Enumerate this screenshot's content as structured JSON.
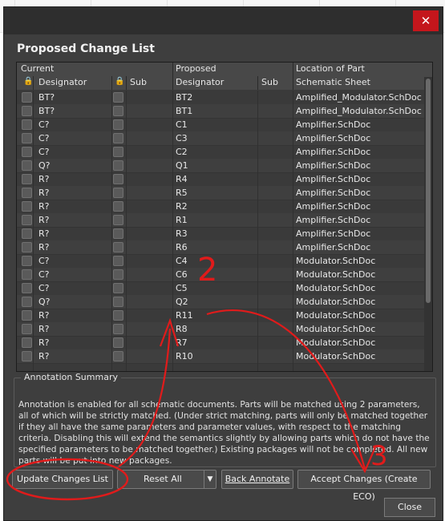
{
  "dialog": {
    "heading": "Proposed Change List",
    "close_x": "✕",
    "close_button": "Close"
  },
  "grid": {
    "group_headers": {
      "current": "Current",
      "proposed": "Proposed",
      "location": "Location of Part"
    },
    "columns": {
      "designator": "Designator",
      "sub": "Sub",
      "proposed_designator": "Designator",
      "proposed_sub": "Sub",
      "schematic_sheet": "Schematic Sheet"
    },
    "rows": [
      {
        "current": "BT?",
        "proposed": "BT2",
        "sheet": "Amplified_Modulator.SchDoc"
      },
      {
        "current": "BT?",
        "proposed": "BT1",
        "sheet": "Amplified_Modulator.SchDoc"
      },
      {
        "current": "C?",
        "proposed": "C1",
        "sheet": "Amplifier.SchDoc"
      },
      {
        "current": "C?",
        "proposed": "C3",
        "sheet": "Amplifier.SchDoc"
      },
      {
        "current": "C?",
        "proposed": "C2",
        "sheet": "Amplifier.SchDoc"
      },
      {
        "current": "Q?",
        "proposed": "Q1",
        "sheet": "Amplifier.SchDoc"
      },
      {
        "current": "R?",
        "proposed": "R4",
        "sheet": "Amplifier.SchDoc"
      },
      {
        "current": "R?",
        "proposed": "R5",
        "sheet": "Amplifier.SchDoc"
      },
      {
        "current": "R?",
        "proposed": "R2",
        "sheet": "Amplifier.SchDoc"
      },
      {
        "current": "R?",
        "proposed": "R1",
        "sheet": "Amplifier.SchDoc"
      },
      {
        "current": "R?",
        "proposed": "R3",
        "sheet": "Amplifier.SchDoc"
      },
      {
        "current": "R?",
        "proposed": "R6",
        "sheet": "Amplifier.SchDoc"
      },
      {
        "current": "C?",
        "proposed": "C4",
        "sheet": "Modulator.SchDoc"
      },
      {
        "current": "C?",
        "proposed": "C6",
        "sheet": "Modulator.SchDoc"
      },
      {
        "current": "C?",
        "proposed": "C5",
        "sheet": "Modulator.SchDoc"
      },
      {
        "current": "Q?",
        "proposed": "Q2",
        "sheet": "Modulator.SchDoc"
      },
      {
        "current": "R?",
        "proposed": "R11",
        "sheet": "Modulator.SchDoc"
      },
      {
        "current": "R?",
        "proposed": "R8",
        "sheet": "Modulator.SchDoc"
      },
      {
        "current": "R?",
        "proposed": "R7",
        "sheet": "Modulator.SchDoc"
      },
      {
        "current": "R?",
        "proposed": "R10",
        "sheet": "Modulator.SchDoc"
      }
    ]
  },
  "summary": {
    "title": "Annotation Summary",
    "text": "Annotation is enabled for all schematic documents. Parts will be matched using 2 parameters, all of which will be strictly matched. (Under strict matching, parts will only be matched together if they all have the same parameters and parameter values, with respect to the matching criteria. Disabling this will extend the semantics slightly by allowing parts which do not have the specified parameters to be matched together.) Existing packages will not be completed. All new parts will be put into new packages."
  },
  "buttons": {
    "update": "Update Changes List",
    "reset": "Reset All",
    "back": "Back Annotate",
    "accept": "Accept Changes (Create ECO)"
  },
  "annotations": {
    "step2": "2",
    "step3": "3"
  },
  "colors": {
    "accent_red": "#c4161c",
    "annotation_red": "#e01b1b",
    "dialog_bg": "#3e3e3e"
  }
}
